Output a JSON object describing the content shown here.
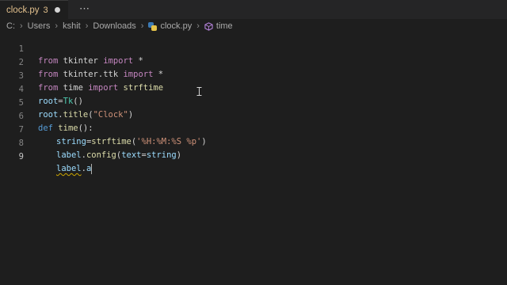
{
  "tab": {
    "filename": "clock.py",
    "problems": "3",
    "overflow": "⋯"
  },
  "breadcrumb": {
    "path": [
      "C:",
      "Users",
      "kshit",
      "Downloads"
    ],
    "file": "clock.py",
    "symbol": "time"
  },
  "editor": {
    "line_numbers": [
      "1",
      "2",
      "3",
      "4",
      "5",
      "6",
      "7",
      "8",
      "9"
    ],
    "lines": [
      [
        "from",
        " tkinter ",
        "import",
        " *"
      ],
      [
        "from",
        " tkinter.ttk ",
        "import",
        " *"
      ],
      [
        "from",
        " time ",
        "import",
        " strftime"
      ],
      [
        "root",
        "=",
        "Tk",
        "()"
      ],
      [
        "root",
        ".",
        "title",
        "(",
        "\"Clock\"",
        ")"
      ],
      [
        "def",
        " ",
        "time",
        "():"
      ],
      [
        "string",
        "=",
        "strftime",
        "(",
        "'%H:%M:%S %p'",
        ")"
      ],
      [
        "label",
        ".",
        "config",
        "(",
        "text",
        "=",
        "string",
        ")"
      ],
      [
        "label",
        ".",
        "a"
      ]
    ]
  },
  "colors": {
    "background": "#1e1e1e",
    "keyword": "#c586c0",
    "function": "#dcdcaa",
    "string": "#ce9178",
    "modified_tab": "#e2c08d"
  }
}
